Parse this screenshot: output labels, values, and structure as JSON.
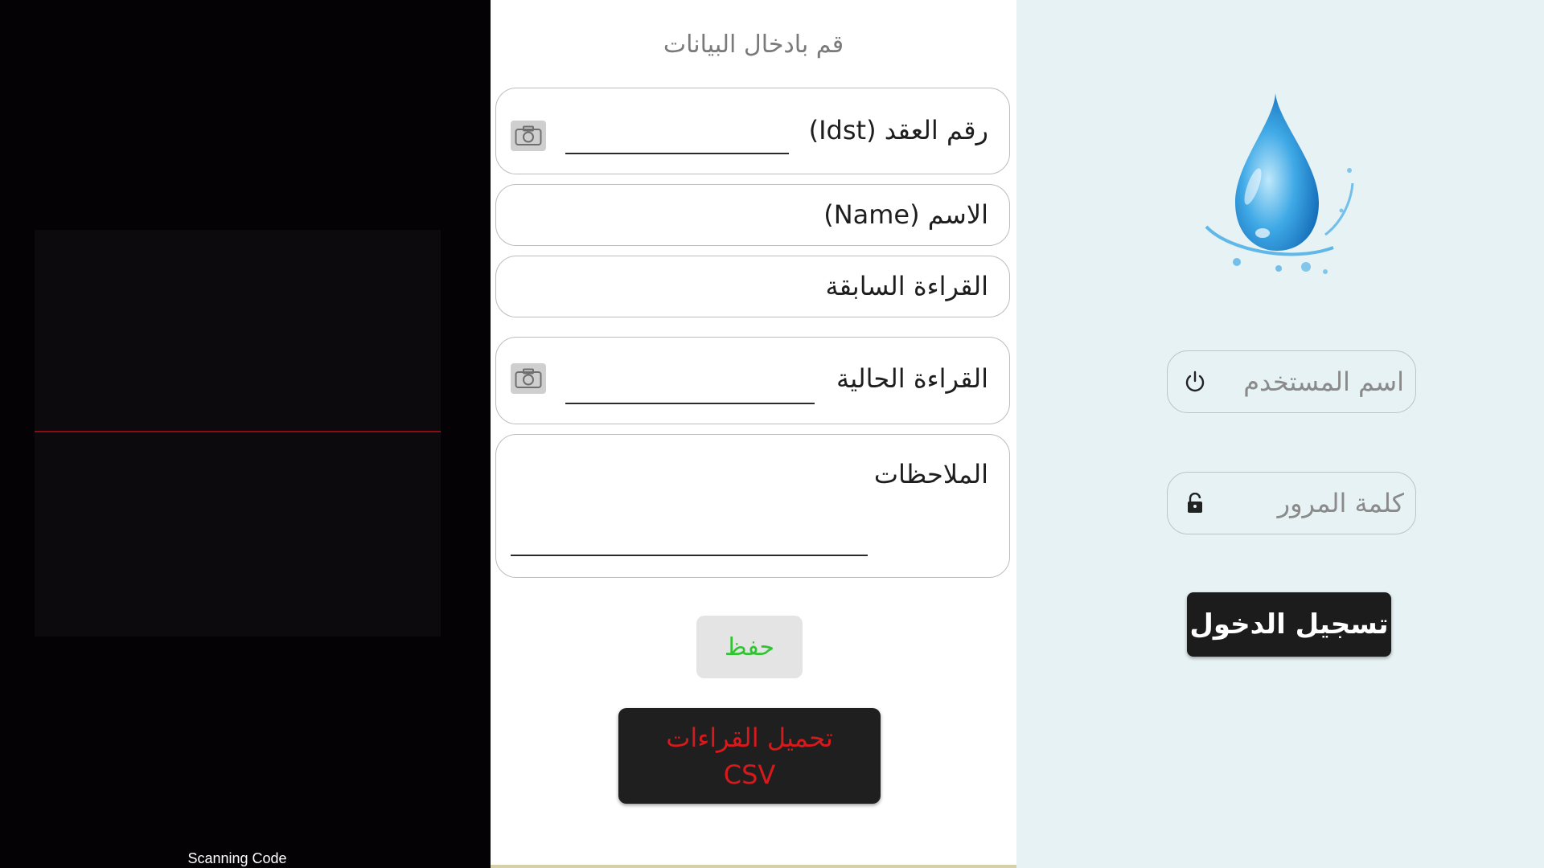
{
  "scanner": {
    "caption": "Scanning Code"
  },
  "form": {
    "title": "قم بادخال البيانات",
    "contract_label": "رقم العقد (Idst)",
    "name_label": "الاسم (Name)",
    "previous_reading_label": "القراءة السابقة",
    "current_reading_label": "القراءة الحالية",
    "notes_label": "الملاحظات",
    "save_label": "حفظ",
    "download_line1": "تحميل القراءات",
    "download_line2": "CSV"
  },
  "login": {
    "username_placeholder": "اسم المستخدم",
    "password_placeholder": "كلمة المرور",
    "login_label": "تسجيل الدخول"
  },
  "icons": {
    "camera": "camera-icon",
    "power": "power-icon",
    "lock": "lock-icon",
    "logo": "water-drop-logo"
  },
  "colors": {
    "save_text": "#31c431",
    "download_text": "#d8191c",
    "scan_line": "#8a0f12",
    "login_bg": "#e6f2f4"
  }
}
